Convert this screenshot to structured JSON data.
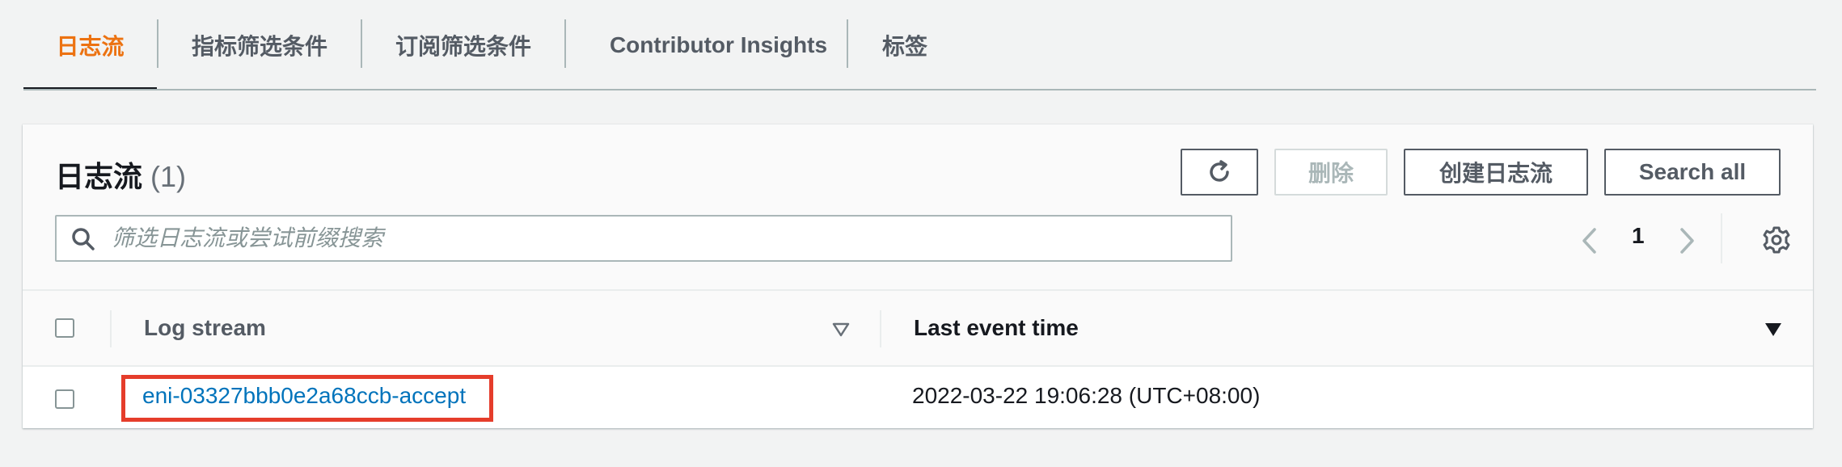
{
  "tabs": [
    {
      "label": "日志流",
      "active": true
    },
    {
      "label": "指标筛选条件"
    },
    {
      "label": "订阅筛选条件"
    },
    {
      "label": "Contributor Insights"
    },
    {
      "label": "标签"
    }
  ],
  "panel": {
    "title": "日志流",
    "count": "(1)",
    "buttons": {
      "refresh_icon": "refresh-icon",
      "delete": "删除",
      "create": "创建日志流",
      "search_all": "Search all"
    },
    "search": {
      "placeholder": "筛选日志流或尝试前缀搜索",
      "value": ""
    },
    "pagination": {
      "current_page": "1"
    }
  },
  "table": {
    "columns": [
      "Log stream",
      "Last event time"
    ],
    "rows": [
      {
        "log_stream": "eni-03327bbb0e2a68ccb-accept",
        "last_event_time": "2022-03-22 19:06:28 (UTC+08:00)"
      }
    ]
  },
  "colors": {
    "accent": "#ec7211",
    "link": "#0073bb",
    "highlight": "#e53d2b"
  }
}
